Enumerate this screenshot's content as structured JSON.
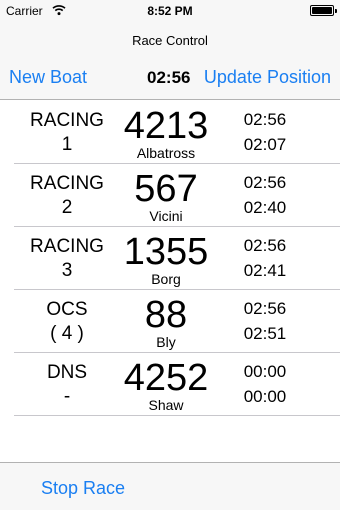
{
  "status_bar": {
    "carrier": "Carrier",
    "time": "8:52 PM",
    "battery_level": 1.0
  },
  "nav": {
    "title": "Race Control",
    "left_button": "New Boat",
    "race_clock": "02:56",
    "right_button": "Update Position"
  },
  "boats": [
    {
      "status": "RACING",
      "position": "1",
      "sail": "4213",
      "name": "Albatross",
      "time1": "02:56",
      "time2": "02:07"
    },
    {
      "status": "RACING",
      "position": "2",
      "sail": "567",
      "name": "Vicini",
      "time1": "02:56",
      "time2": "02:40"
    },
    {
      "status": "RACING",
      "position": "3",
      "sail": "1355",
      "name": "Borg",
      "time1": "02:56",
      "time2": "02:41"
    },
    {
      "status": "OCS",
      "position": "( 4 )",
      "sail": "88",
      "name": "Bly",
      "time1": "02:56",
      "time2": "02:51"
    },
    {
      "status": "DNS",
      "position": "-",
      "sail": "4252",
      "name": "Shaw",
      "time1": "00:00",
      "time2": "00:00"
    }
  ],
  "toolbar": {
    "stop_button": "Stop Race"
  },
  "colors": {
    "accent": "#1a7ff2",
    "bar_background": "#f7f7f7",
    "separator": "#c8c7cc"
  },
  "icons": {
    "wifi": "wifi-icon",
    "battery": "battery-icon"
  }
}
